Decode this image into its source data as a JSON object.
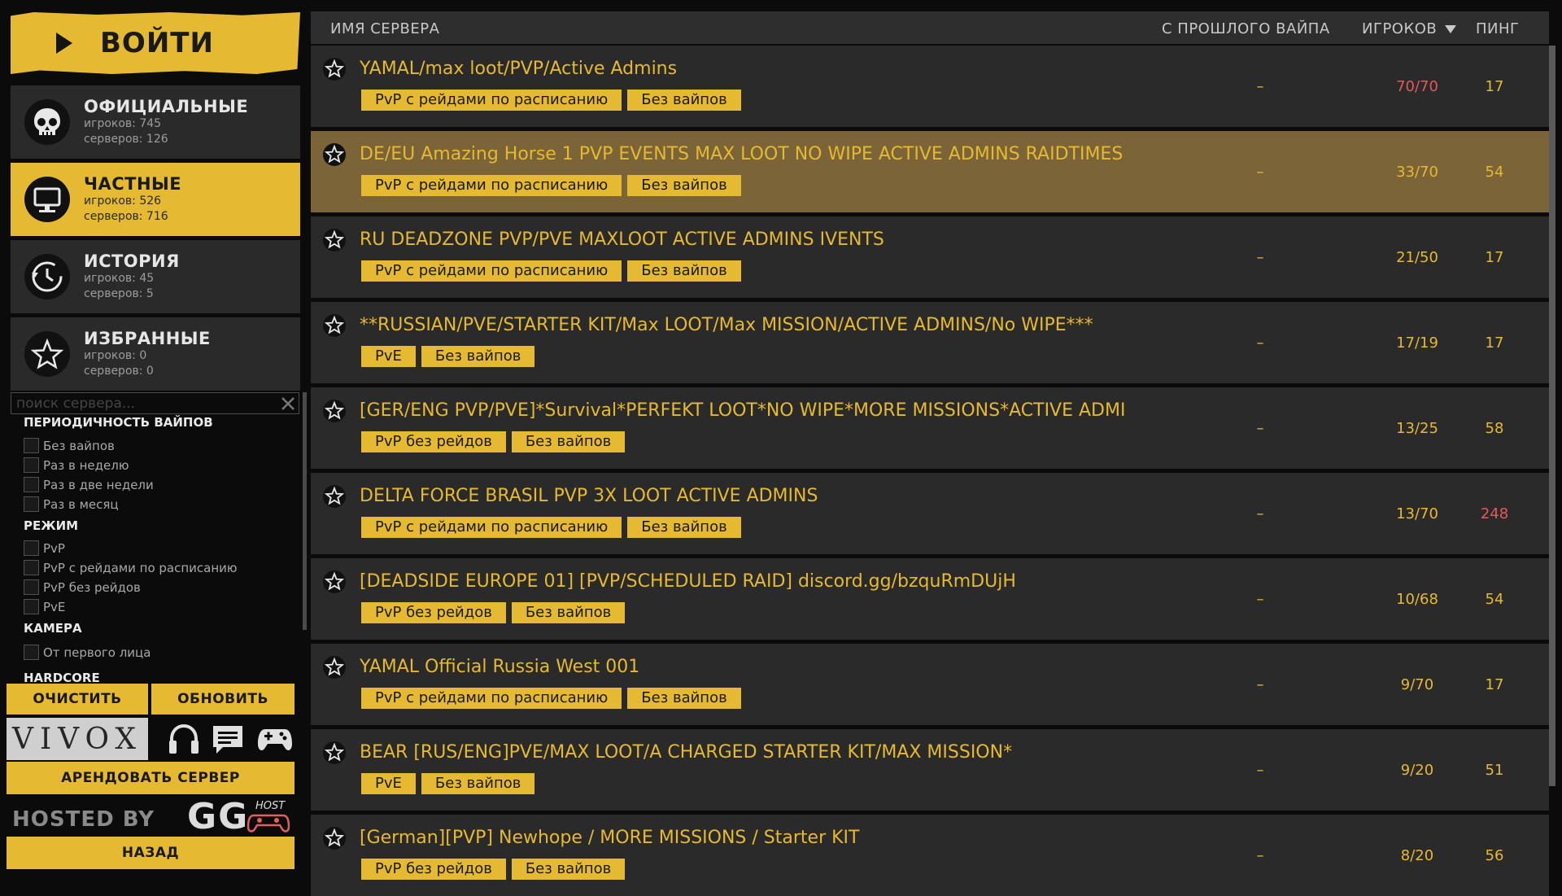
{
  "login": {
    "label": "ВОЙТИ"
  },
  "categories": [
    {
      "name": "ОФИЦИАЛЬНЫЕ",
      "players": "игроков: 745",
      "servers": "серверов: 126",
      "icon": "skull-icon"
    },
    {
      "name": "ЧАСТНЫЕ",
      "players": "игроков: 526",
      "servers": "серверов: 716",
      "icon": "monitor-icon"
    },
    {
      "name": "ИСТОРИЯ",
      "players": "игроков: 45",
      "servers": "серверов: 5",
      "icon": "clock-icon"
    },
    {
      "name": "ИЗБРАННЫЕ",
      "players": "игроков: 0",
      "servers": "серверов: 0",
      "icon": "star-icon"
    }
  ],
  "search": {
    "placeholder": "поиск сервера..."
  },
  "filters": {
    "wipe_title": "ПЕРИОДИЧНОСТЬ ВАЙПОВ",
    "wipe": [
      "Без вайпов",
      "Раз в неделю",
      "Раз в две недели",
      "Раз в месяц"
    ],
    "mode_title": "РЕЖИМ",
    "mode": [
      "PvP",
      "PvP с рейдами по расписанию",
      "PvP без рейдов",
      "PvE"
    ],
    "camera_title": "КАМЕРА",
    "camera": [
      "От первого лица"
    ],
    "hardcore_title": "HARDCORE"
  },
  "buttons": {
    "clear": "ОЧИСТИТЬ",
    "refresh": "ОБНОВИТЬ",
    "rent": "АРЕНДОВАТЬ СЕРВЕР",
    "back": "НАЗАД"
  },
  "vivox": "VIVOX",
  "hosted_by": "HOSTED BY",
  "gg": "GG",
  "host_logo_text": "HOST",
  "header": {
    "name": "ИМЯ СЕРВЕРА",
    "since_wipe": "С ПРОШЛОГО ВАЙПА",
    "players": "ИГРОКОВ",
    "ping": "ПИНГ"
  },
  "servers": [
    {
      "name": "YAMAL/max loot/PVP/Active Admins",
      "tags": [
        "PvP с рейдами по расписанию",
        "Без вайпов"
      ],
      "wipe": "–",
      "players": "70/70",
      "ping": "17",
      "full": true
    },
    {
      "name": "DE/EU Amazing Horse 1 PVP EVENTS MAX LOOT NO WIPE ACTIVE ADMINS RAIDTIMES",
      "tags": [
        "PvP с рейдами по расписанию",
        "Без вайпов"
      ],
      "wipe": "–",
      "players": "33/70",
      "ping": "54",
      "selected": true
    },
    {
      "name": "RU DEADZONE PVP/PVE MAXLOOT ACTIVE ADMINS IVENTS",
      "tags": [
        "PvP с рейдами по расписанию",
        "Без вайпов"
      ],
      "wipe": "–",
      "players": "21/50",
      "ping": "17"
    },
    {
      "name": "**RUSSIAN/PVE/STARTER KIT/Max LOOT/Max MISSION/ACTIVE ADMINS/No WIPE***",
      "tags": [
        "PvE",
        "Без вайпов"
      ],
      "wipe": "–",
      "players": "17/19",
      "ping": "17"
    },
    {
      "name": "[GER/ENG PVP/PVE]*Survival*PERFEKT LOOT*NO WIPE*MORE MISSIONS*ACTIVE ADMI",
      "tags": [
        "PvP без рейдов",
        "Без вайпов"
      ],
      "wipe": "–",
      "players": "13/25",
      "ping": "58"
    },
    {
      "name": "DELTA FORCE BRASIL PVP 3X LOOT ACTIVE ADMINS",
      "tags": [
        "PvP с рейдами по расписанию",
        "Без вайпов"
      ],
      "wipe": "–",
      "players": "13/70",
      "ping": "248",
      "high_ping": true
    },
    {
      "name": "[DEADSIDE EUROPE 01] [PVP/SCHEDULED RAID] discord.gg/bzquRmDUjH",
      "tags": [
        "PvP без рейдов",
        "Без вайпов"
      ],
      "wipe": "–",
      "players": "10/68",
      "ping": "54"
    },
    {
      "name": "YAMAL Official Russia West 001",
      "tags": [
        "PvP с рейдами по расписанию",
        "Без вайпов"
      ],
      "wipe": "–",
      "players": "9/70",
      "ping": "17"
    },
    {
      "name": "BEAR [RUS/ENG]PVE/MAX LOOT/A CHARGED STARTER KIT/MAX MISSION*",
      "tags": [
        "PvE",
        "Без вайпов"
      ],
      "wipe": "–",
      "players": "9/20",
      "ping": "51"
    },
    {
      "name": "[German][PVP] Newhope / MORE MISSIONS / Starter KIT",
      "tags": [
        "PvP без рейдов",
        "Без вайпов"
      ],
      "wipe": "–",
      "players": "8/20",
      "ping": "56"
    }
  ],
  "colors": {
    "accent": "#e6b932",
    "selected_row": "#7b6437",
    "row": "#2a2a2a",
    "warning": "#e35a5a"
  }
}
